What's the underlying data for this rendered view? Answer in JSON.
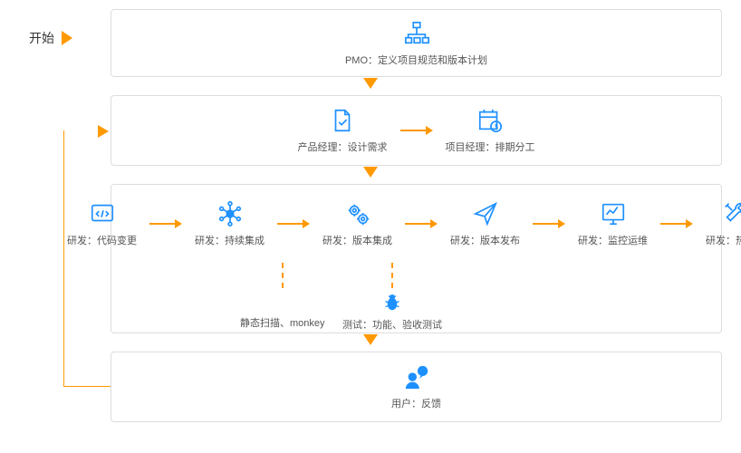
{
  "start_label": "开始",
  "box1": {
    "n1": "PMO：定义项目规范和版本计划"
  },
  "box2": {
    "n1": "产品经理：设计需求",
    "n2": "项目经理：排期分工"
  },
  "box3": {
    "n1": "研发：代码变更",
    "n2": "研发：持续集成",
    "n3": "研发：版本集成",
    "n4": "研发：版本发布",
    "n5": "研发：监控运维",
    "n6": "研发：热修复",
    "s1": "静态扫描、monkey",
    "s2": "测试：功能、验收测试"
  },
  "box4": {
    "n1": "用户：反馈"
  },
  "colors": {
    "accent": "#ff9900",
    "icon": "#1e90ff"
  }
}
